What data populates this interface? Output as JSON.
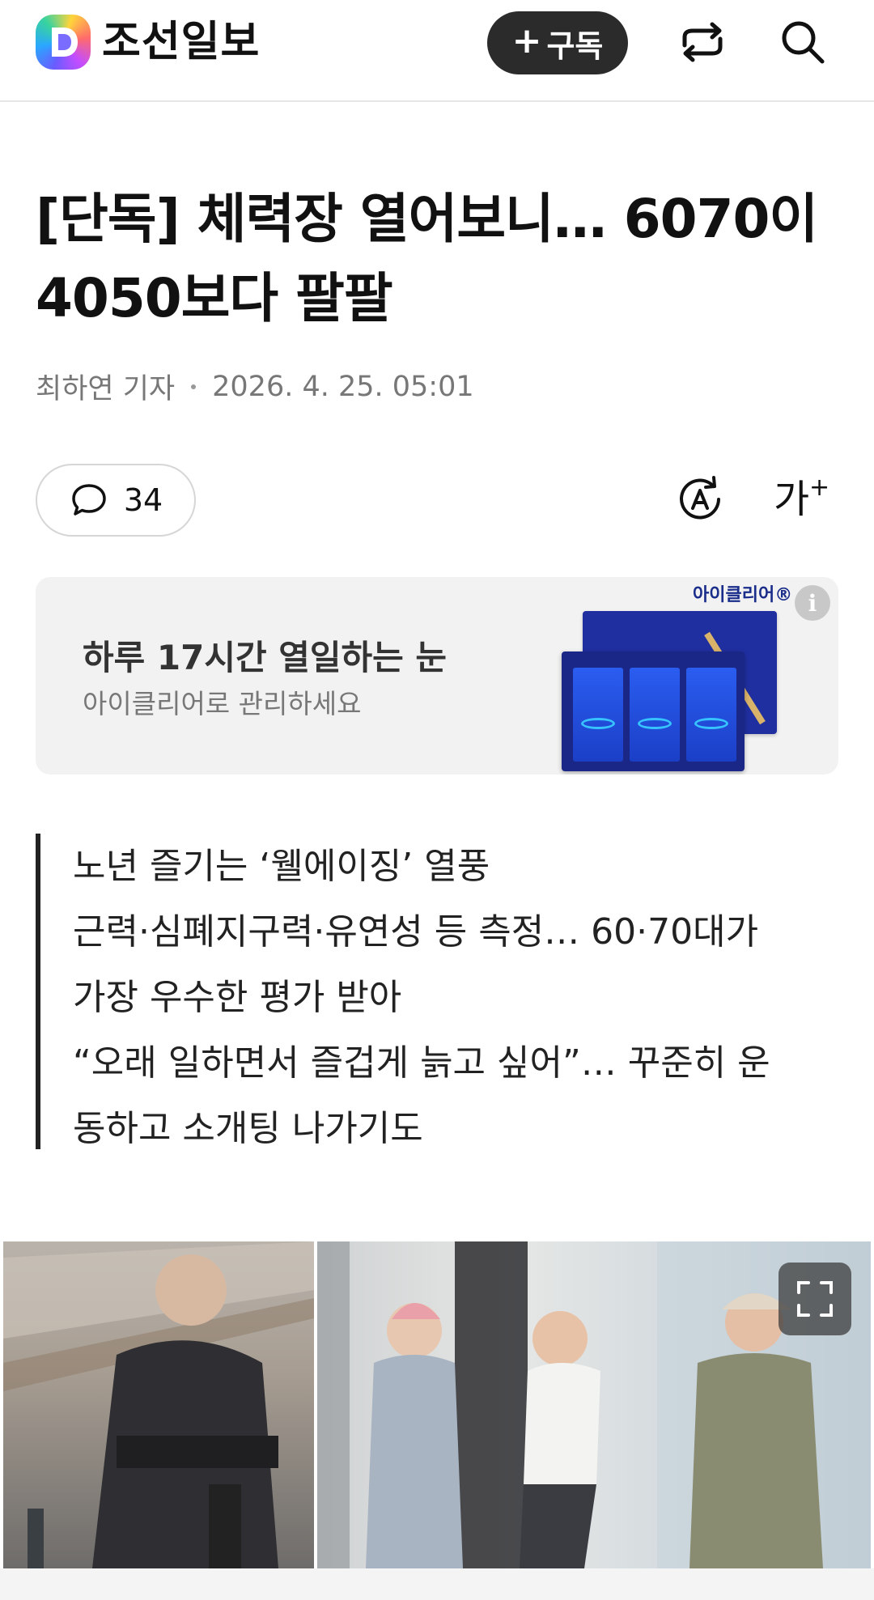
{
  "header": {
    "logo_letter": "D",
    "site_name": "조선일보",
    "subscribe_label": "구독",
    "share_icon": "share-icon",
    "search_icon": "search-icon"
  },
  "article": {
    "title": "[단독] 체력장 열어보니… 6070이 4050보다 팔팔",
    "author": "최하연 기자",
    "date": "2026. 4. 25. 05:01",
    "comment_count": "34",
    "translate_icon": "translate-icon",
    "font_size_label": "가"
  },
  "ad": {
    "headline": "하루 17시간 열일하는 눈",
    "sub": "아이클리어로 관리하세요",
    "brand": "아이클리어®",
    "info_icon": "i"
  },
  "summary": [
    "노년 즐기는 ‘웰에이징’ 열풍",
    "근력·심폐지구력·유연성 등 측정… 60·70대가",
    "가장 우수한 평가 받아",
    "“오래 일하면서 즐겁게 늙고 싶어”… 꾸준히 운",
    "동하고 소개팅 나가기도"
  ],
  "colors": {
    "subscribe_bg": "#2b2b2b",
    "ad_bg": "#f2f2f2",
    "summary_bar": "#222222"
  }
}
